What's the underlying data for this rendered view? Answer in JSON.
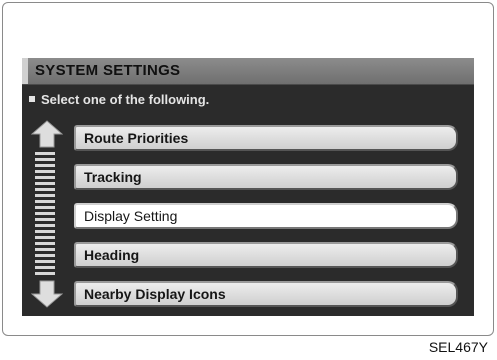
{
  "screen": {
    "title": "SYSTEM SETTINGS",
    "instruction": "Select one of the following.",
    "menu_items": [
      {
        "label": "Route Priorities",
        "selected": false
      },
      {
        "label": "Tracking",
        "selected": false
      },
      {
        "label": "Display Setting",
        "selected": true
      },
      {
        "label": "Heading",
        "selected": false
      },
      {
        "label": "Nearby Display Icons",
        "selected": false
      }
    ],
    "scroll": {
      "up_icon": "arrow-up-icon",
      "down_icon": "arrow-down-icon"
    }
  },
  "caption": "SEL467Y",
  "colors": {
    "screen_background": "#2b2b2b",
    "title_bar": "#7d7d7d",
    "button_face": "#e0e0e0",
    "selected_button": "#ffffff"
  }
}
